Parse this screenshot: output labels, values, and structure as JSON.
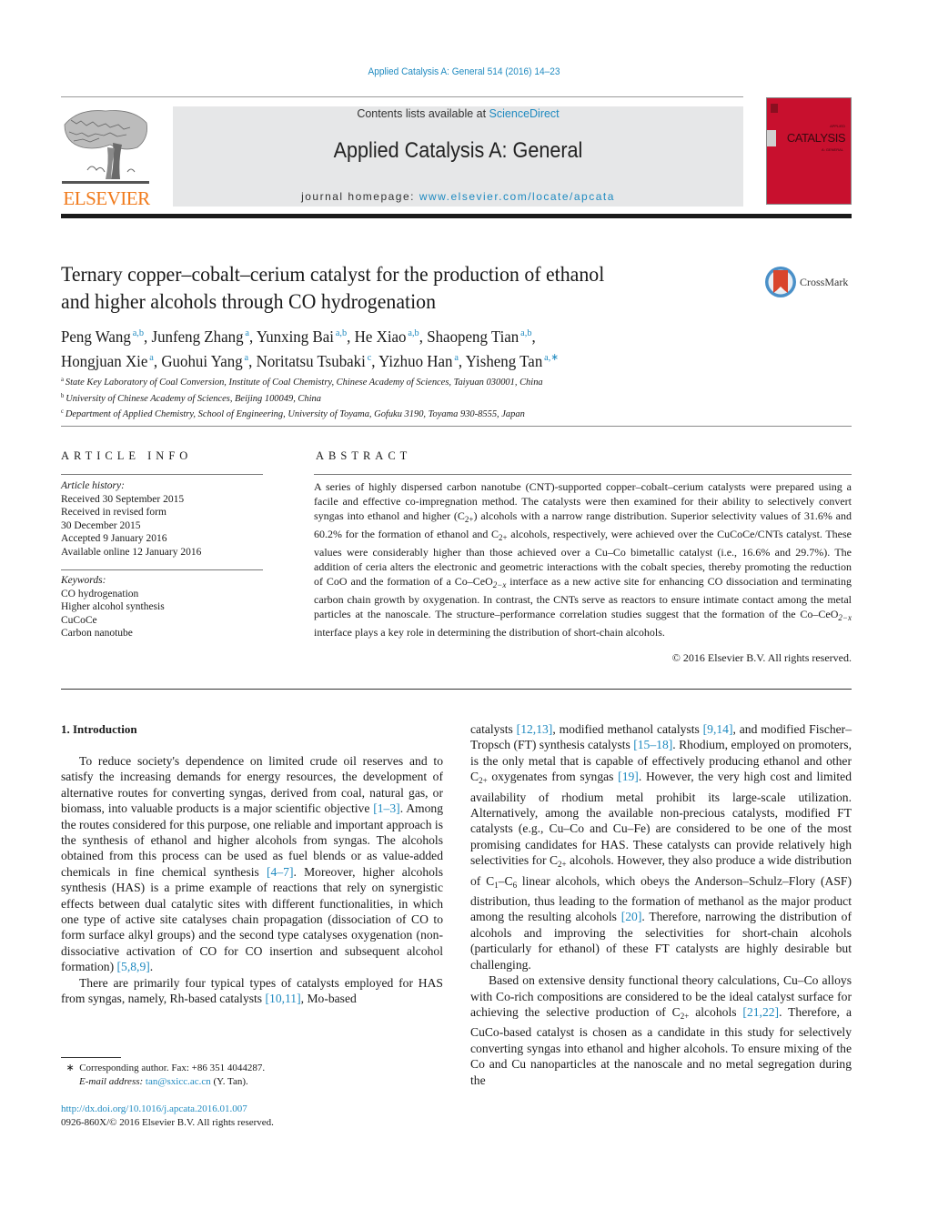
{
  "running_head": "Applied Catalysis A: General 514 (2016) 14–23",
  "masthead": {
    "contents_prefix": "Contents lists available at ",
    "contents_link": "ScienceDirect",
    "journal_title": "Applied Catalysis A: General",
    "homepage_prefix": "journal homepage: ",
    "homepage_link": "www.elsevier.com/locate/apcata",
    "publisher": "ELSEVIER",
    "cover_word": "CATALYSIS",
    "brand_colors": {
      "elsevier_orange": "#f07a1b",
      "link_blue": "#1f8ac0",
      "cover_red": "#c8102e"
    }
  },
  "article": {
    "title_line1": "Ternary copper–cobalt–cerium catalyst for the production of ethanol",
    "title_line2": "and higher alcohols through CO hydrogenation",
    "crossmark_label": "CrossMark",
    "authors": [
      {
        "name": "Peng Wang",
        "aff": "a,b"
      },
      {
        "name": "Junfeng Zhang",
        "aff": "a"
      },
      {
        "name": "Yunxing Bai",
        "aff": "a,b"
      },
      {
        "name": "He Xiao",
        "aff": "a,b"
      },
      {
        "name": "Shaopeng Tian",
        "aff": "a,b"
      },
      {
        "name": "Hongjuan Xie",
        "aff": "a"
      },
      {
        "name": "Guohui Yang",
        "aff": "a"
      },
      {
        "name": "Noritatsu Tsubaki",
        "aff": "c"
      },
      {
        "name": "Yizhuo Han",
        "aff": "a"
      },
      {
        "name": "Yisheng Tan",
        "aff": "a,∗"
      }
    ],
    "affiliations": [
      {
        "key": "a",
        "text": "State Key Laboratory of Coal Conversion, Institute of Coal Chemistry, Chinese Academy of Sciences, Taiyuan 030001, China"
      },
      {
        "key": "b",
        "text": "University of Chinese Academy of Sciences, Beijing 100049, China"
      },
      {
        "key": "c",
        "text": "Department of Applied Chemistry, School of Engineering, University of Toyama, Gofuku 3190, Toyama 930-8555, Japan"
      }
    ]
  },
  "article_info": {
    "heading": "ARTICLE INFO",
    "history_label": "Article history:",
    "history": [
      "Received 30 September 2015",
      "Received in revised form",
      "30 December 2015",
      "Accepted 9 January 2016",
      "Available online 12 January 2016"
    ],
    "keywords_label": "Keywords:",
    "keywords": [
      "CO hydrogenation",
      "Higher alcohol synthesis",
      "CuCoCe",
      "Carbon nanotube"
    ]
  },
  "abstract": {
    "heading": "ABSTRACT",
    "parts": [
      "A series of highly dispersed carbon nanotube (CNT)-supported copper–cobalt–cerium catalysts were prepared using a facile and effective co-impregnation method. The catalysts were then examined for their ability to selectively convert syngas into ethanol and higher (C",
      "2+",
      ") alcohols with a narrow range distribution. Superior selectivity values of 31.6% and 60.2% for the formation of ethanol and C",
      "2+",
      " alcohols, respectively, were achieved over the CuCoCe/CNTs catalyst. These values were considerably higher than those achieved over a Cu–Co bimetallic catalyst (i.e., 16.6% and 29.7%). The addition of ceria alters the electronic and geometric interactions with the cobalt species, thereby promoting the reduction of CoO and the formation of a Co–CeO",
      "2−x",
      " interface as a new active site for enhancing CO dissociation and terminating carbon chain growth by oxygenation. In contrast, the CNTs serve as reactors to ensure intimate contact among the metal particles at the nanoscale. The structure–performance correlation studies suggest that the formation of the Co–CeO",
      "2−x",
      " interface plays a key role in determining the distribution of short-chain alcohols."
    ],
    "copyright": "© 2016 Elsevier B.V. All rights reserved."
  },
  "body": {
    "section_heading": "1.  Introduction",
    "left": {
      "p1": [
        "To reduce society's dependence on limited crude oil reserves and to satisfy the increasing demands for energy resources, the development of alternative routes for converting syngas, derived from coal, natural gas, or biomass, into valuable products is a major scientific objective ",
        "[1–3]",
        ". Among the routes considered for this purpose, one reliable and important approach is the synthesis of ethanol and higher alcohols from syngas. The alcohols obtained from this process can be used as fuel blends or as value-added chemicals in fine chemical synthesis ",
        "[4–7]",
        ". Moreover, higher alcohols synthesis (HAS) is a prime example of reactions that rely on synergistic effects between dual catalytic sites with different functionalities, in which one type of active site catalyses chain propagation (dissociation of CO to form surface alkyl groups) and the second type catalyses oxygenation (non-dissociative activation of CO for CO insertion and subsequent alcohol formation) ",
        "[5,8,9]",
        "."
      ],
      "p2": [
        "There are primarily four typical types of catalysts employed for HAS from syngas, namely, Rh-based catalysts ",
        "[10,11]",
        ", Mo-based"
      ]
    },
    "right": {
      "p1": [
        "catalysts ",
        "[12,13]",
        ", modified methanol catalysts ",
        "[9,14]",
        ", and modified Fischer–Tropsch (FT) synthesis catalysts ",
        "[15–18]",
        ". Rhodium, employed on promoters, is the only metal that is capable of effectively producing ethanol and other C",
        "2+",
        " oxygenates from syngas ",
        "[19]",
        ". However, the very high cost and limited availability of rhodium metal prohibit its large-scale utilization. Alternatively, among the available non-precious catalysts, modified FT catalysts (e.g., Cu–Co and Cu–Fe) are considered to be one of the most promising candidates for HAS. These catalysts can provide relatively high selectivities for C",
        "2+",
        " alcohols. However, they also produce a wide distribution of C",
        "1",
        "–C",
        "6",
        " linear alcohols, which obeys the Anderson–Schulz–Flory (ASF) distribution, thus leading to the formation of methanol as the major product among the resulting alcohols ",
        "[20]",
        ". Therefore, narrowing the distribution of alcohols and improving the selectivities for short-chain alcohols (particularly for ethanol) of these FT catalysts are highly desirable but challenging."
      ],
      "p2": [
        "Based on extensive density functional theory calculations, Cu–Co alloys with Co-rich compositions are considered to be the ideal catalyst surface for achieving the selective production of C",
        "2+",
        " alcohols ",
        "[21,22]",
        ". Therefore, a CuCo-based catalyst is chosen as a candidate in this study for selectively converting syngas into ethanol and higher alcohols. To ensure mixing of the Co and Cu nanoparticles at the nanoscale and no metal segregation during the"
      ]
    }
  },
  "footnotes": {
    "star": "∗",
    "corresponding": "Corresponding author. Fax: +86 351 4044287.",
    "email_label": "E-mail address: ",
    "email": "tan@sxicc.ac.cn",
    "email_suffix": " (Y. Tan).",
    "doi": "http://dx.doi.org/10.1016/j.apcata.2016.01.007",
    "issn_line": "0926-860X/© 2016 Elsevier B.V. All rights reserved."
  }
}
